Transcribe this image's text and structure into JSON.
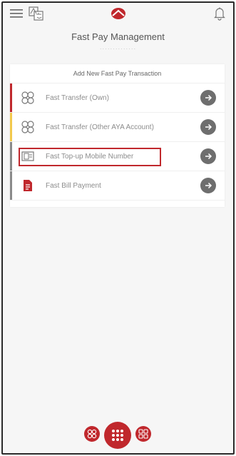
{
  "header": {
    "title": "Fast Pay Management",
    "dots": "··············",
    "menu_icon": "hamburger-menu-icon",
    "language_icon": "language-switch-icon",
    "logo": "aya-bank-logo",
    "notification_icon": "bell-icon"
  },
  "card": {
    "heading": "Add New Fast Pay Transaction",
    "items": [
      {
        "label": "Fast Transfer (Own)",
        "icon": "transfer-circles-icon",
        "accent": "#c0282d"
      },
      {
        "label": "Fast Transfer (Other AYA Account)",
        "icon": "transfer-circles-icon",
        "accent": "#f2c94c"
      },
      {
        "label": "Fast Top-up Mobile Number",
        "icon": "mobile-topup-icon",
        "accent": "#8a8a8a",
        "highlighted": true
      },
      {
        "label": "Fast Bill Payment",
        "icon": "bill-document-icon",
        "accent": "#8a8a8a"
      }
    ]
  },
  "bottom_nav": {
    "left_icon": "transfer-circles-icon",
    "center_icon": "grid-menu-icon",
    "right_icon": "dashboard-grid-icon"
  },
  "colors": {
    "brand_red": "#c0282d",
    "accent_yellow": "#f2c94c",
    "arrow_grey": "#6e6e6e"
  }
}
